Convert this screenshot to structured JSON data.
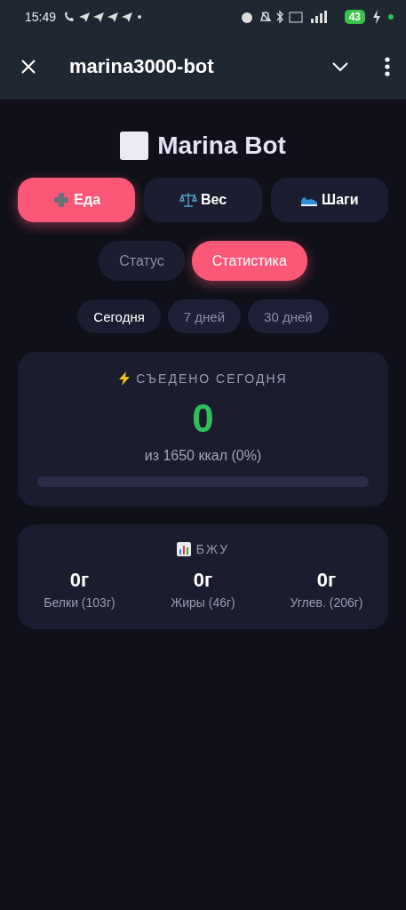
{
  "status_bar": {
    "time": "15:49",
    "battery": "43"
  },
  "app_bar": {
    "title": "marina3000-bot"
  },
  "header": {
    "title": "Marina Bot"
  },
  "actions": [
    {
      "label": "Еда",
      "kind": "plus",
      "selected": true
    },
    {
      "label": "Вес",
      "kind": "scales",
      "selected": false
    },
    {
      "label": "Шаги",
      "kind": "shoe",
      "selected": false
    }
  ],
  "tabs": [
    {
      "label": "Статус",
      "selected": false
    },
    {
      "label": "Статистика",
      "selected": true
    }
  ],
  "periods": [
    {
      "label": "Сегодня",
      "selected": true
    },
    {
      "label": "7 дней",
      "selected": false
    },
    {
      "label": "30 дней",
      "selected": false
    }
  ],
  "calories": {
    "title": "СЪЕДЕНО СЕГОДНЯ",
    "value": "0",
    "subtitle": "из 1650 ккал (0%)",
    "level": 0
  },
  "macros": {
    "title": "БЖУ",
    "items": [
      {
        "value": "0г",
        "label": "Белки (103г)"
      },
      {
        "value": "0г",
        "label": "Жиры (46г)"
      },
      {
        "value": "0г",
        "label": "Углев. (206г)"
      }
    ]
  }
}
